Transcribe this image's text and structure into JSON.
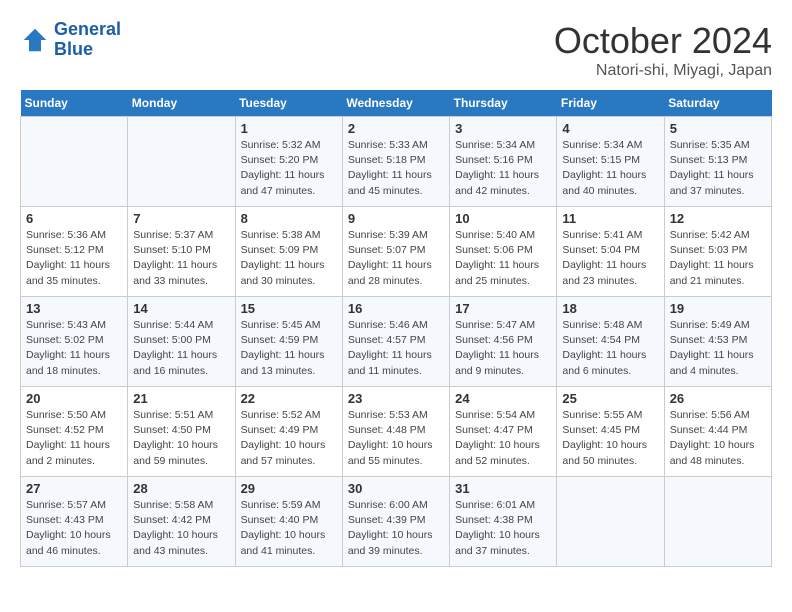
{
  "header": {
    "logo_line1": "General",
    "logo_line2": "Blue",
    "title": "October 2024",
    "subtitle": "Natori-shi, Miyagi, Japan"
  },
  "columns": [
    "Sunday",
    "Monday",
    "Tuesday",
    "Wednesday",
    "Thursday",
    "Friday",
    "Saturday"
  ],
  "weeks": [
    [
      {
        "day": "",
        "info": ""
      },
      {
        "day": "",
        "info": ""
      },
      {
        "day": "1",
        "info": "Sunrise: 5:32 AM\nSunset: 5:20 PM\nDaylight: 11 hours and 47 minutes."
      },
      {
        "day": "2",
        "info": "Sunrise: 5:33 AM\nSunset: 5:18 PM\nDaylight: 11 hours and 45 minutes."
      },
      {
        "day": "3",
        "info": "Sunrise: 5:34 AM\nSunset: 5:16 PM\nDaylight: 11 hours and 42 minutes."
      },
      {
        "day": "4",
        "info": "Sunrise: 5:34 AM\nSunset: 5:15 PM\nDaylight: 11 hours and 40 minutes."
      },
      {
        "day": "5",
        "info": "Sunrise: 5:35 AM\nSunset: 5:13 PM\nDaylight: 11 hours and 37 minutes."
      }
    ],
    [
      {
        "day": "6",
        "info": "Sunrise: 5:36 AM\nSunset: 5:12 PM\nDaylight: 11 hours and 35 minutes."
      },
      {
        "day": "7",
        "info": "Sunrise: 5:37 AM\nSunset: 5:10 PM\nDaylight: 11 hours and 33 minutes."
      },
      {
        "day": "8",
        "info": "Sunrise: 5:38 AM\nSunset: 5:09 PM\nDaylight: 11 hours and 30 minutes."
      },
      {
        "day": "9",
        "info": "Sunrise: 5:39 AM\nSunset: 5:07 PM\nDaylight: 11 hours and 28 minutes."
      },
      {
        "day": "10",
        "info": "Sunrise: 5:40 AM\nSunset: 5:06 PM\nDaylight: 11 hours and 25 minutes."
      },
      {
        "day": "11",
        "info": "Sunrise: 5:41 AM\nSunset: 5:04 PM\nDaylight: 11 hours and 23 minutes."
      },
      {
        "day": "12",
        "info": "Sunrise: 5:42 AM\nSunset: 5:03 PM\nDaylight: 11 hours and 21 minutes."
      }
    ],
    [
      {
        "day": "13",
        "info": "Sunrise: 5:43 AM\nSunset: 5:02 PM\nDaylight: 11 hours and 18 minutes."
      },
      {
        "day": "14",
        "info": "Sunrise: 5:44 AM\nSunset: 5:00 PM\nDaylight: 11 hours and 16 minutes."
      },
      {
        "day": "15",
        "info": "Sunrise: 5:45 AM\nSunset: 4:59 PM\nDaylight: 11 hours and 13 minutes."
      },
      {
        "day": "16",
        "info": "Sunrise: 5:46 AM\nSunset: 4:57 PM\nDaylight: 11 hours and 11 minutes."
      },
      {
        "day": "17",
        "info": "Sunrise: 5:47 AM\nSunset: 4:56 PM\nDaylight: 11 hours and 9 minutes."
      },
      {
        "day": "18",
        "info": "Sunrise: 5:48 AM\nSunset: 4:54 PM\nDaylight: 11 hours and 6 minutes."
      },
      {
        "day": "19",
        "info": "Sunrise: 5:49 AM\nSunset: 4:53 PM\nDaylight: 11 hours and 4 minutes."
      }
    ],
    [
      {
        "day": "20",
        "info": "Sunrise: 5:50 AM\nSunset: 4:52 PM\nDaylight: 11 hours and 2 minutes."
      },
      {
        "day": "21",
        "info": "Sunrise: 5:51 AM\nSunset: 4:50 PM\nDaylight: 10 hours and 59 minutes."
      },
      {
        "day": "22",
        "info": "Sunrise: 5:52 AM\nSunset: 4:49 PM\nDaylight: 10 hours and 57 minutes."
      },
      {
        "day": "23",
        "info": "Sunrise: 5:53 AM\nSunset: 4:48 PM\nDaylight: 10 hours and 55 minutes."
      },
      {
        "day": "24",
        "info": "Sunrise: 5:54 AM\nSunset: 4:47 PM\nDaylight: 10 hours and 52 minutes."
      },
      {
        "day": "25",
        "info": "Sunrise: 5:55 AM\nSunset: 4:45 PM\nDaylight: 10 hours and 50 minutes."
      },
      {
        "day": "26",
        "info": "Sunrise: 5:56 AM\nSunset: 4:44 PM\nDaylight: 10 hours and 48 minutes."
      }
    ],
    [
      {
        "day": "27",
        "info": "Sunrise: 5:57 AM\nSunset: 4:43 PM\nDaylight: 10 hours and 46 minutes."
      },
      {
        "day": "28",
        "info": "Sunrise: 5:58 AM\nSunset: 4:42 PM\nDaylight: 10 hours and 43 minutes."
      },
      {
        "day": "29",
        "info": "Sunrise: 5:59 AM\nSunset: 4:40 PM\nDaylight: 10 hours and 41 minutes."
      },
      {
        "day": "30",
        "info": "Sunrise: 6:00 AM\nSunset: 4:39 PM\nDaylight: 10 hours and 39 minutes."
      },
      {
        "day": "31",
        "info": "Sunrise: 6:01 AM\nSunset: 4:38 PM\nDaylight: 10 hours and 37 minutes."
      },
      {
        "day": "",
        "info": ""
      },
      {
        "day": "",
        "info": ""
      }
    ]
  ]
}
